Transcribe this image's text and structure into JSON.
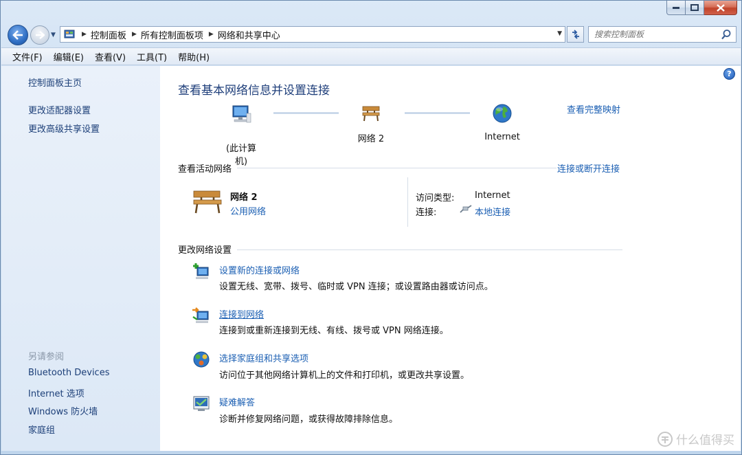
{
  "window": {
    "caption_buttons": [
      "minimize",
      "maximize",
      "close"
    ]
  },
  "address": {
    "crumbs": [
      "控制面板",
      "所有控制面板项",
      "网络和共享中心"
    ]
  },
  "search": {
    "placeholder": "搜索控制面板"
  },
  "menu": [
    "文件(F)",
    "编辑(E)",
    "查看(V)",
    "工具(T)",
    "帮助(H)"
  ],
  "sidebar": {
    "home": "控制面板主页",
    "links": [
      "更改适配器设置",
      "更改高级共享设置"
    ],
    "see_also_heading": "另请参阅",
    "see_also": [
      "Bluetooth Devices",
      "Internet 选项",
      "Windows 防火墙",
      "家庭组"
    ]
  },
  "main": {
    "title": "查看基本网络信息并设置连接",
    "map": {
      "computer_label": "(此计算机)",
      "network_label": "网络 2",
      "internet_label": "Internet",
      "full_map_link": "查看完整映射"
    },
    "active": {
      "heading": "查看活动网络",
      "connect_link": "连接或断开连接",
      "network_name": "网络 2",
      "network_type": "公用网络",
      "access_type_label": "访问类型:",
      "access_type_value": "Internet",
      "connections_label": "连接:",
      "connections_value": "本地连接"
    },
    "change": {
      "heading": "更改网络设置",
      "tasks": [
        {
          "title": "设置新的连接或网络",
          "desc": "设置无线、宽带、拨号、临时或 VPN 连接；或设置路由器或访问点。"
        },
        {
          "title": "连接到网络",
          "desc": "连接到或重新连接到无线、有线、拨号或 VPN 网络连接。"
        },
        {
          "title": "选择家庭组和共享选项",
          "desc": "访问位于其他网络计算机上的文件和打印机，或更改共享设置。"
        },
        {
          "title": "疑难解答",
          "desc": "诊断并修复网络问题，或获得故障排除信息。"
        }
      ]
    }
  },
  "watermark": "什么值得买",
  "colors": {
    "link": "#1b5fb3",
    "title": "#1e3e7a",
    "sidebar_link": "#1c3f78"
  }
}
